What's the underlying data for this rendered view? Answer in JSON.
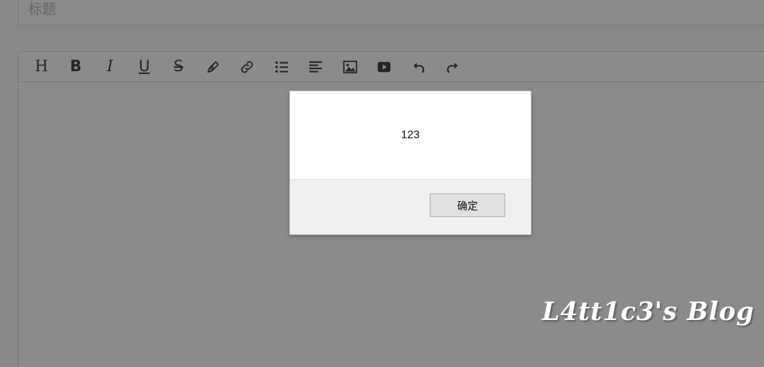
{
  "title_field": {
    "placeholder": "标题"
  },
  "toolbar": {
    "heading_label": "H",
    "bold_label": "B",
    "italic_label": "I",
    "underline_label": "U",
    "strike_label": "S",
    "icons": [
      "heading-icon",
      "bold-icon",
      "italic-icon",
      "underline-icon",
      "strikethrough-icon",
      "pencil-icon",
      "link-icon",
      "list-icon",
      "align-left-icon",
      "image-icon",
      "video-icon",
      "undo-icon",
      "redo-icon"
    ]
  },
  "dialog": {
    "message": "123",
    "confirm_label": "确定"
  },
  "watermark": {
    "text": "L4tt1c3's Blog"
  },
  "colors": {
    "backdrop": "#8c8c8c",
    "dialog_footer": "#f0f0f0",
    "button_bg": "#e1e1e1"
  }
}
